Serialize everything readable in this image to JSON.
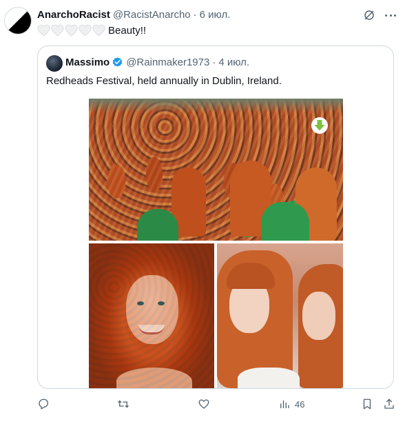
{
  "tweet": {
    "display_name": "AnarchoRacist",
    "handle": "@RacistAnarcho",
    "separator": "·",
    "date": "6 июл.",
    "text": "Beauty!!",
    "hearts_count_icons": 5
  },
  "quoted_tweet": {
    "display_name": "Massimo",
    "handle": "@Rainmaker1973",
    "separator": "·",
    "date": "4 июл.",
    "text": "Redheads Festival, held annually in Dublin, Ireland.",
    "verified": true
  },
  "media": {
    "images": [
      {
        "icon": "crowd-photo"
      },
      {
        "icon": "portrait-photo"
      },
      {
        "icon": "two-women-photo"
      }
    ],
    "download_icon": "download-arrow-icon"
  },
  "actions": {
    "reply_icon": "reply-icon",
    "retweet_icon": "retweet-icon",
    "like_icon": "like-icon",
    "views_icon": "views-icon",
    "views_count": "46",
    "bookmark_icon": "bookmark-icon",
    "share_icon": "share-icon"
  },
  "colors": {
    "text_primary": "#0f1419",
    "text_secondary": "#536471",
    "border": "#cfd9de",
    "verified_blue": "#1d9bf0",
    "download_green": "#7cc242"
  }
}
